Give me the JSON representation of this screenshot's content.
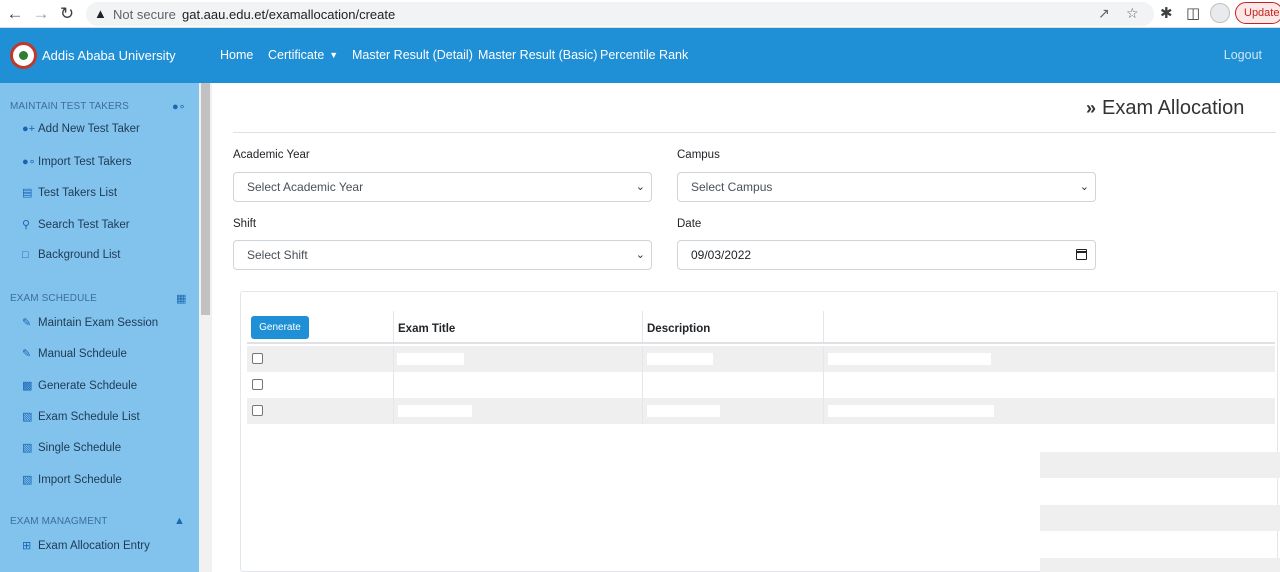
{
  "browser": {
    "not_secure_text": "Not secure",
    "url": "gat.aau.edu.et/examallocation/create",
    "update_label": "Update"
  },
  "navbar": {
    "brand": "Addis Ababa University",
    "items": [
      {
        "label": "Home"
      },
      {
        "label": "Certificate",
        "has_dropdown": true
      },
      {
        "label": "Master Result (Detail)"
      },
      {
        "label": "Master Result (Basic)"
      },
      {
        "label": "Percentile Rank"
      }
    ],
    "logout": "Logout"
  },
  "sidebar": {
    "sections": [
      {
        "heading": "MAINTAIN TEST TAKERS",
        "icon": "user-cog-icon",
        "items": [
          {
            "label": "Add New Test Taker",
            "icon": "user-plus-icon"
          },
          {
            "label": "Import Test Takers",
            "icon": "user-cog-icon"
          },
          {
            "label": "Test Takers List",
            "icon": "id-card-icon"
          },
          {
            "label": "Search Test Taker",
            "icon": "search-icon"
          },
          {
            "label": "Background List",
            "icon": "file-icon"
          }
        ]
      },
      {
        "heading": "EXAM SCHEDULE",
        "icon": "calendar-icon",
        "items": [
          {
            "label": "Maintain Exam Session",
            "icon": "edit-icon"
          },
          {
            "label": "Manual Schdeule",
            "icon": "edit-icon"
          },
          {
            "label": "Generate Schdeule",
            "icon": "gift-icon"
          },
          {
            "label": "Exam Schedule List",
            "icon": "clipboard-icon"
          },
          {
            "label": "Single Schedule",
            "icon": "clipboard-icon"
          },
          {
            "label": "Import Schedule",
            "icon": "clipboard-icon"
          }
        ]
      },
      {
        "heading": "EXAM MANAGMENT",
        "icon": "user-tie-icon",
        "items": [
          {
            "label": "Exam Allocation Entry",
            "icon": "plus-square-icon"
          }
        ]
      }
    ]
  },
  "main": {
    "title": "Exam Allocation",
    "form": {
      "academic_year_label": "Academic Year",
      "academic_year_value": "Select Academic Year",
      "campus_label": "Campus",
      "campus_value": "Select Campus",
      "shift_label": "Shift",
      "shift_value": "Select Shift",
      "date_label": "Date",
      "date_value": "09/03/2022"
    },
    "table": {
      "generate_label": "Generate",
      "columns": [
        "Exam Title",
        "Description",
        ""
      ],
      "row_count": 3
    }
  },
  "colors": {
    "navbar": "#1f8fd6",
    "sidebar": "#82c3ee",
    "primary_button": "#1f8fd6"
  }
}
